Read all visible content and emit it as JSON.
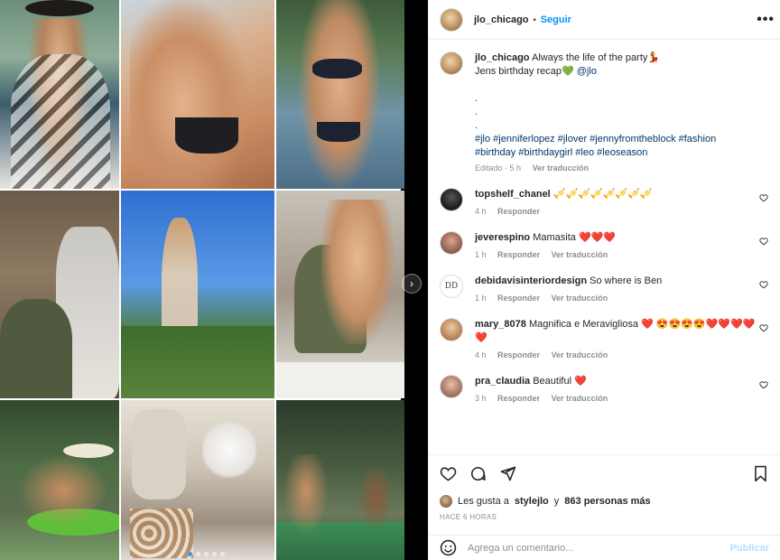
{
  "post": {
    "username": "jlo_chicago",
    "follow_label": "Seguir",
    "separator": "•",
    "more_label": "•••"
  },
  "caption": {
    "username": "jlo_chicago",
    "line1": "Always the life of the party💃",
    "line2_text": "Jens birthday recap💚",
    "mention": "@jlo",
    "dots": [
      ".",
      ".",
      "."
    ],
    "hashtags_line1": "#jlo #jenniferlopez #jlover #jennyfromtheblock #fashion",
    "hashtags_line2": "#birthday #birthdaygirl #leo #leoseason",
    "edited": "Editado · 5 h",
    "translate": "Ver traducción"
  },
  "comments": [
    {
      "user": "topshelf_chanel",
      "text": "🎺🎺🎺🎺🎺🎺🎺🎺",
      "time": "4 h",
      "reply": "Responder",
      "translate": ""
    },
    {
      "user": "jeverespino",
      "text": "Mamasita ❤️❤️❤️",
      "time": "1 h",
      "reply": "Responder",
      "translate": "Ver traducción"
    },
    {
      "user": "debidavisinteriordesign",
      "text": "So where is Ben",
      "time": "1 h",
      "reply": "Responder",
      "translate": "Ver traducción"
    },
    {
      "user": "mary_8078",
      "text": "Magnifica e Meravigliosa ❤️ 😍😍😍😍❤️❤️❤️❤️❤️",
      "time": "4 h",
      "reply": "Responder",
      "translate": "Ver traducción"
    },
    {
      "user": "pra_claudia",
      "text": "Beautiful ❤️",
      "time": "3 h",
      "reply": "Responder",
      "translate": "Ver traducción"
    }
  ],
  "avatar_text": {
    "debidavis": "DD"
  },
  "likes": {
    "prefix": "Les gusta a",
    "user": "stylejlo",
    "connector": "y",
    "count": "863 personas más"
  },
  "time_ago": "HACE 6 HORAS",
  "comment_input": {
    "placeholder": "Agrega un comentario...",
    "publish": "Publicar"
  },
  "carousel": {
    "count": 5,
    "active": 1
  },
  "colors": {
    "link": "#00376b",
    "follow": "#0095f6",
    "heart": "#ed4956"
  },
  "icons": [
    "heart-icon",
    "comment-icon",
    "share-icon",
    "bookmark-icon",
    "emoji-icon",
    "chevron-right-icon",
    "like-heart-icon"
  ]
}
